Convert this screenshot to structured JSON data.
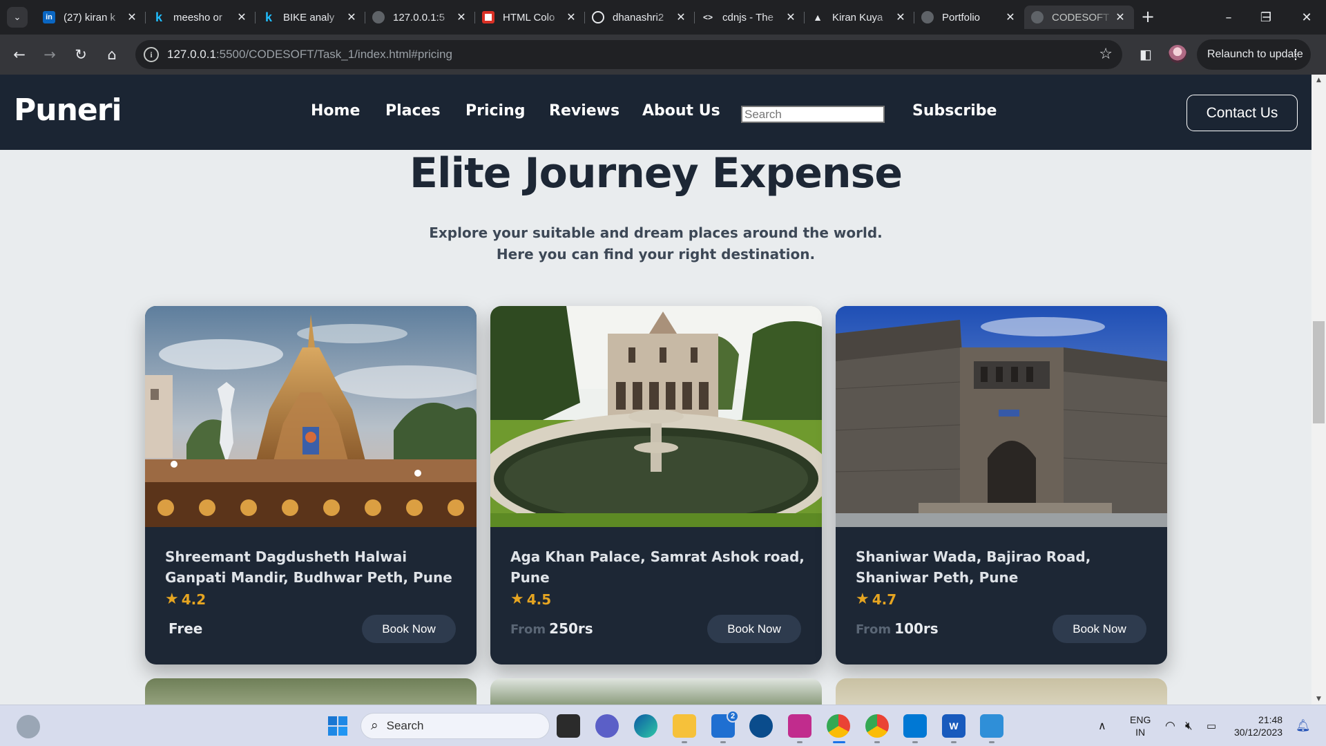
{
  "browser": {
    "tabs": [
      {
        "title": "(27) kiran k",
        "icon": "linkedin-icon",
        "color": "#0a66c2"
      },
      {
        "title": "meesho or",
        "icon": "kaggle-icon",
        "color": "#20beff"
      },
      {
        "title": "BIKE analy",
        "icon": "kaggle-icon",
        "color": "#20beff"
      },
      {
        "title": "127.0.0.1:5",
        "icon": "globe-icon",
        "color": "#9aa0a6"
      },
      {
        "title": "HTML Colo",
        "icon": "color-picker-icon",
        "color": "#d93025"
      },
      {
        "title": "dhanashri2",
        "icon": "github-icon",
        "color": "#e8eaed"
      },
      {
        "title": "cdnjs - The",
        "icon": "code-icon",
        "color": "#e8eaed"
      },
      {
        "title": "Kiran Kuya",
        "icon": "vercel-icon",
        "color": "#e8eaed"
      },
      {
        "title": "Portfolio",
        "icon": "globe-icon",
        "color": "#9aa0a6"
      },
      {
        "title": "CODESOFT",
        "icon": "globe-icon",
        "color": "#9aa0a6"
      }
    ],
    "active_tab": 9,
    "url_host": "127.0.0.1",
    "url_rest": ":5500/CODESOFT/Task_1/index.html#pricing",
    "relaunch_label": "Relaunch to update"
  },
  "site": {
    "brand": "Puneri",
    "nav": [
      "Home",
      "Places",
      "Pricing",
      "Reviews",
      "About Us"
    ],
    "search_placeholder": "Search",
    "subscribe": "Subscribe",
    "contact": "Contact Us"
  },
  "section": {
    "title": "Elite Journey Expense",
    "subtitle_line1": "Explore your suitable and dream places around the world.",
    "subtitle_line2": "Here you can find your right destination."
  },
  "cards": [
    {
      "title": "Shreemant Dagdusheth Halwai Ganpati Mandir, Budhwar Peth, Pune",
      "rating": "4.2",
      "from": "",
      "price": "Free",
      "button": "Book Now",
      "image": "temple-photo"
    },
    {
      "title": "Aga Khan Palace, Samrat Ashok road, Pune",
      "rating": "4.5",
      "from": "From",
      "price": "250rs",
      "button": "Book Now",
      "image": "palace-fountain-photo"
    },
    {
      "title": "Shaniwar Wada, Bajirao Road, Shaniwar Peth, Pune",
      "rating": "4.7",
      "from": "From",
      "price": "100rs",
      "button": "Book Now",
      "image": "fort-gate-photo"
    }
  ],
  "taskbar": {
    "search_label": "Search",
    "lang_line1": "ENG",
    "lang_line2": "IN",
    "time": "21:48",
    "date": "30/12/2023",
    "mail_badge": "2"
  },
  "colors": {
    "navbar_bg": "#1b2533",
    "card_bg": "#1d2735",
    "page_bg": "#e9ecee",
    "rating": "#e6a521",
    "button_bg": "#2e3b4e"
  }
}
